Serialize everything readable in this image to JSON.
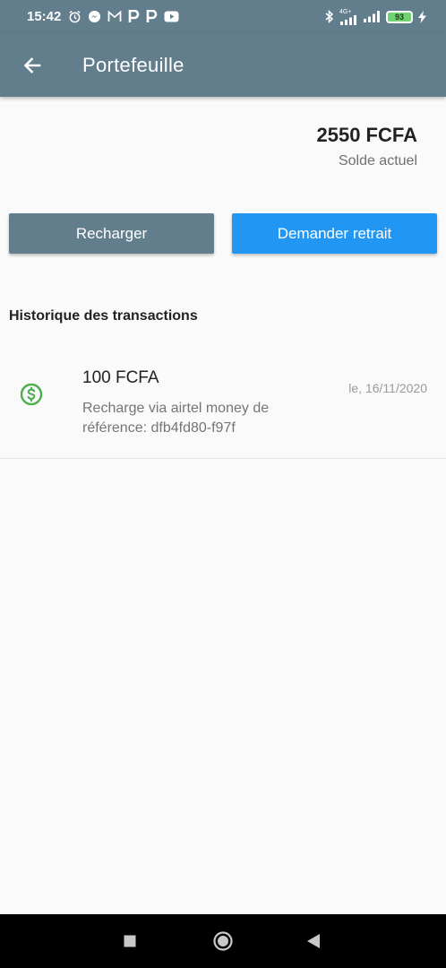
{
  "status_bar": {
    "time": "15:42",
    "battery": "93",
    "network": "4G+",
    "icons": [
      "alarm-icon",
      "messenger-icon",
      "gmail-icon",
      "p-app-icon",
      "p-app-icon",
      "youtube-icon",
      "bluetooth-icon",
      "signal-icon",
      "signal-icon",
      "battery-icon",
      "charging-icon"
    ]
  },
  "app_bar": {
    "title": "Portefeuille",
    "back_icon": "arrow-left-icon",
    "color": "#627e8d"
  },
  "balance": {
    "amount": "2550 FCFA",
    "label": "Solde actuel"
  },
  "actions": {
    "recharge_label": "Recharger",
    "recharge_color": "#627e8d",
    "withdraw_label": "Demander retrait",
    "withdraw_color": "#2196f3"
  },
  "history": {
    "title": "Historique des transactions",
    "transactions": [
      {
        "icon": "dollar-circle-icon",
        "icon_color": "#4caf50",
        "amount": "100 FCFA",
        "description": "Recharge via airtel money de référence: dfb4fd80-f97f",
        "date": "le, 16/11/2020"
      }
    ]
  },
  "nav_bar": {
    "icons": [
      "recent-apps-icon",
      "home-icon",
      "back-icon"
    ]
  }
}
